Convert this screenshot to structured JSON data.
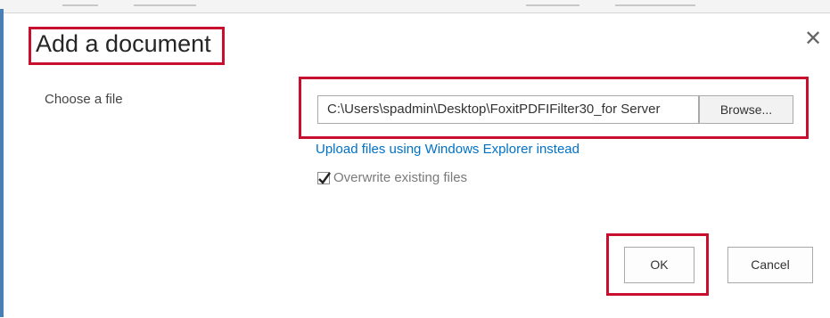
{
  "dialog": {
    "title": "Add a document",
    "close_icon": "close-icon",
    "choose_label": "Choose a file",
    "file_path": "C:\\Users\\spadmin\\Desktop\\FoxitPDFIFilter30_for Server",
    "browse_label": "Browse...",
    "upload_link": "Upload files using Windows Explorer instead",
    "overwrite_label": "Overwrite existing files",
    "overwrite_checked": true,
    "ok_label": "OK",
    "cancel_label": "Cancel"
  },
  "colors": {
    "highlight": "#c8102e",
    "link": "#0072c6",
    "edge": "#4a7fb5"
  }
}
